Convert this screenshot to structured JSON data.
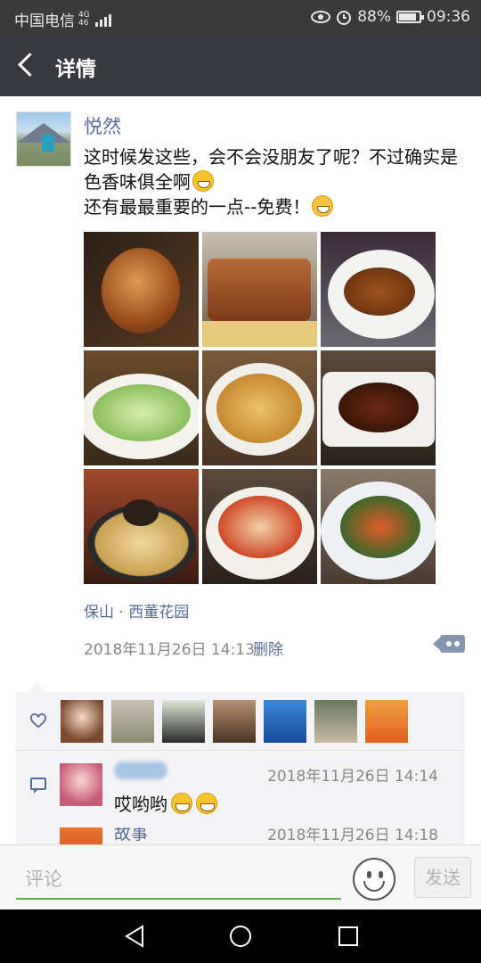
{
  "status_bar": {
    "carrier": "中国电信",
    "network_top": "4G",
    "network_bottom": "46",
    "battery": "88%",
    "time": "09:36",
    "battery_level": 0.88,
    "icons": [
      "signal-icon",
      "eye-icon",
      "alarm-icon",
      "battery-icon"
    ]
  },
  "header": {
    "title": "详情",
    "back_icon": "chevron-left-icon"
  },
  "post": {
    "author": "悦然",
    "text_line1": "这时候发这些，会不会没朋友了呢？不过确实是色香味俱全啊",
    "text_line2": "还有最最重要的一点--免费！",
    "emoji1": "grin-emoji",
    "emoji2": "thinking-emoji",
    "photos": [
      {
        "subject": "roast-duck"
      },
      {
        "subject": "sliced-roast-meat"
      },
      {
        "subject": "braised-duck"
      },
      {
        "subject": "cucumber-salad"
      },
      {
        "subject": "stir-fried-vegetables"
      },
      {
        "subject": "stir-fried-pork"
      },
      {
        "subject": "hot-pot-rice"
      },
      {
        "subject": "chili-fish"
      },
      {
        "subject": "chili-stir-fry"
      }
    ],
    "location": "保山 · 西董花园",
    "datetime": "2018年11月26日 14:13",
    "delete_label": "删除",
    "more_icon": "comment-more-icon"
  },
  "likes": {
    "icon": "heart-icon",
    "count_shown": 7
  },
  "comments": [
    {
      "name": "",
      "time": "2018年11月26日 14:14",
      "text": "哎哟哟",
      "emoji": [
        "grin-emoji",
        "grin-emoji"
      ]
    },
    {
      "name": "故事",
      "time": "2018年11月26日 14:18",
      "text": ""
    }
  ],
  "compose": {
    "placeholder": "评论",
    "send_label": "发送",
    "emoji_icon": "smiley-icon"
  },
  "nav": {
    "back_icon": "nav-back-icon",
    "home_icon": "nav-home-icon",
    "recent_icon": "nav-recent-icon"
  },
  "colors": {
    "link": "#576b95",
    "title_bar": "#393a3f",
    "accent_green": "#55b849"
  }
}
